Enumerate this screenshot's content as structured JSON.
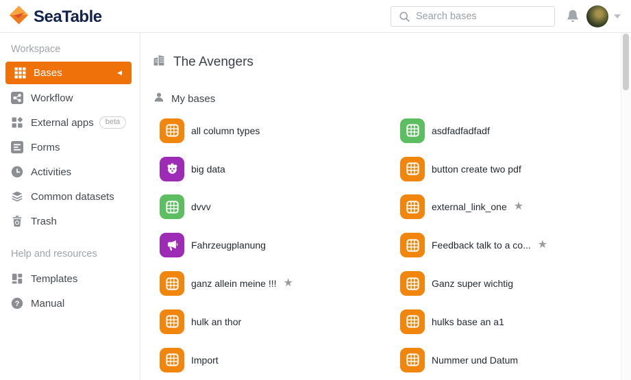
{
  "header": {
    "brand": "SeaTable",
    "search_placeholder": "Search bases"
  },
  "sidebar": {
    "workspace_label": "Workspace",
    "items": [
      {
        "label": "Bases",
        "icon": "grid-icon",
        "active": true
      },
      {
        "label": "Workflow",
        "icon": "workflow-icon"
      },
      {
        "label": "External apps",
        "icon": "apps-icon",
        "badge": "beta"
      },
      {
        "label": "Forms",
        "icon": "form-icon"
      },
      {
        "label": "Activities",
        "icon": "clock-icon"
      },
      {
        "label": "Common datasets",
        "icon": "layers-icon"
      },
      {
        "label": "Trash",
        "icon": "trash-icon"
      }
    ],
    "help_label": "Help and resources",
    "help_items": [
      {
        "label": "Templates",
        "icon": "templates-icon"
      },
      {
        "label": "Manual",
        "icon": "question-icon"
      }
    ]
  },
  "main": {
    "workspace_title": "The Avengers",
    "section_title": "My bases",
    "bases_left": [
      {
        "label": "all column types",
        "icon": "table-icon",
        "color": "#F0860D",
        "starred": false
      },
      {
        "label": "big data",
        "icon": "big-data-icon",
        "color": "#9E2BB5",
        "starred": false
      },
      {
        "label": "dvvv",
        "icon": "table-icon",
        "color": "#5CBE60",
        "starred": false
      },
      {
        "label": "Fahrzeugplanung",
        "icon": "megaphone-icon",
        "color": "#9E2BB5",
        "starred": false
      },
      {
        "label": "ganz allein meine !!!",
        "icon": "table-icon",
        "color": "#F0860D",
        "starred": true
      },
      {
        "label": "hulk an thor",
        "icon": "table-icon",
        "color": "#F0860D",
        "starred": false
      },
      {
        "label": "Import",
        "icon": "table-icon",
        "color": "#F0860D",
        "starred": false
      }
    ],
    "bases_right": [
      {
        "label": "asdfadfadfadf",
        "icon": "table-icon",
        "color": "#5CBE60",
        "starred": false
      },
      {
        "label": "button create two pdf",
        "icon": "table-icon",
        "color": "#F0860D",
        "starred": false
      },
      {
        "label": "external_link_one",
        "icon": "table-icon",
        "color": "#F0860D",
        "starred": true
      },
      {
        "label": "Feedback talk to a co...",
        "icon": "table-icon",
        "color": "#F0860D",
        "starred": true
      },
      {
        "label": "Ganz super wichtig",
        "icon": "table-icon",
        "color": "#F0860D",
        "starred": false
      },
      {
        "label": "hulks base an a1",
        "icon": "table-icon",
        "color": "#F0860D",
        "starred": false
      },
      {
        "label": "Nummer und Datum",
        "icon": "table-icon",
        "color": "#F0860D",
        "starred": false
      }
    ]
  },
  "colors": {
    "accent_orange": "#EF7109",
    "tile_orange": "#F0860D",
    "tile_green": "#5CBE60",
    "tile_purple": "#9E2BB5",
    "brand_navy": "#13234B",
    "star_gray": "#9B9B9B"
  }
}
